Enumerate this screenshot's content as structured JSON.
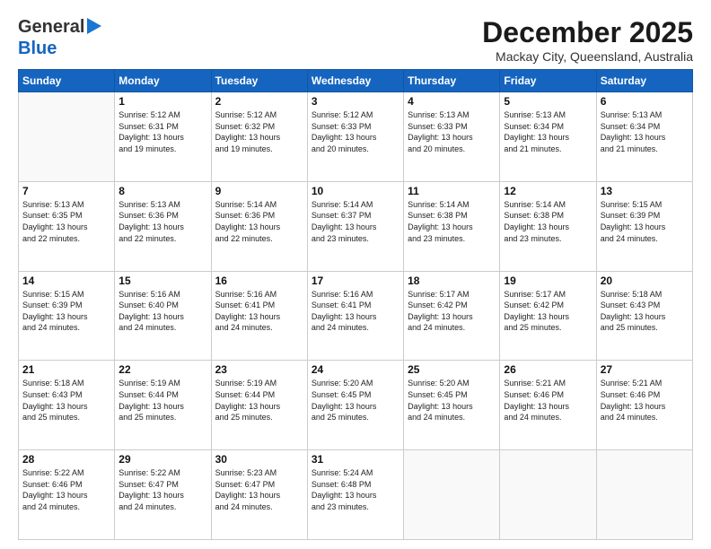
{
  "logo": {
    "line1": "General",
    "line2": "Blue"
  },
  "title": "December 2025",
  "subtitle": "Mackay City, Queensland, Australia",
  "weekdays": [
    "Sunday",
    "Monday",
    "Tuesday",
    "Wednesday",
    "Thursday",
    "Friday",
    "Saturday"
  ],
  "weeks": [
    [
      {
        "day": "",
        "info": ""
      },
      {
        "day": "1",
        "info": "Sunrise: 5:12 AM\nSunset: 6:31 PM\nDaylight: 13 hours\nand 19 minutes."
      },
      {
        "day": "2",
        "info": "Sunrise: 5:12 AM\nSunset: 6:32 PM\nDaylight: 13 hours\nand 19 minutes."
      },
      {
        "day": "3",
        "info": "Sunrise: 5:12 AM\nSunset: 6:33 PM\nDaylight: 13 hours\nand 20 minutes."
      },
      {
        "day": "4",
        "info": "Sunrise: 5:13 AM\nSunset: 6:33 PM\nDaylight: 13 hours\nand 20 minutes."
      },
      {
        "day": "5",
        "info": "Sunrise: 5:13 AM\nSunset: 6:34 PM\nDaylight: 13 hours\nand 21 minutes."
      },
      {
        "day": "6",
        "info": "Sunrise: 5:13 AM\nSunset: 6:34 PM\nDaylight: 13 hours\nand 21 minutes."
      }
    ],
    [
      {
        "day": "7",
        "info": "Sunrise: 5:13 AM\nSunset: 6:35 PM\nDaylight: 13 hours\nand 22 minutes."
      },
      {
        "day": "8",
        "info": "Sunrise: 5:13 AM\nSunset: 6:36 PM\nDaylight: 13 hours\nand 22 minutes."
      },
      {
        "day": "9",
        "info": "Sunrise: 5:14 AM\nSunset: 6:36 PM\nDaylight: 13 hours\nand 22 minutes."
      },
      {
        "day": "10",
        "info": "Sunrise: 5:14 AM\nSunset: 6:37 PM\nDaylight: 13 hours\nand 23 minutes."
      },
      {
        "day": "11",
        "info": "Sunrise: 5:14 AM\nSunset: 6:38 PM\nDaylight: 13 hours\nand 23 minutes."
      },
      {
        "day": "12",
        "info": "Sunrise: 5:14 AM\nSunset: 6:38 PM\nDaylight: 13 hours\nand 23 minutes."
      },
      {
        "day": "13",
        "info": "Sunrise: 5:15 AM\nSunset: 6:39 PM\nDaylight: 13 hours\nand 24 minutes."
      }
    ],
    [
      {
        "day": "14",
        "info": "Sunrise: 5:15 AM\nSunset: 6:39 PM\nDaylight: 13 hours\nand 24 minutes."
      },
      {
        "day": "15",
        "info": "Sunrise: 5:16 AM\nSunset: 6:40 PM\nDaylight: 13 hours\nand 24 minutes."
      },
      {
        "day": "16",
        "info": "Sunrise: 5:16 AM\nSunset: 6:41 PM\nDaylight: 13 hours\nand 24 minutes."
      },
      {
        "day": "17",
        "info": "Sunrise: 5:16 AM\nSunset: 6:41 PM\nDaylight: 13 hours\nand 24 minutes."
      },
      {
        "day": "18",
        "info": "Sunrise: 5:17 AM\nSunset: 6:42 PM\nDaylight: 13 hours\nand 24 minutes."
      },
      {
        "day": "19",
        "info": "Sunrise: 5:17 AM\nSunset: 6:42 PM\nDaylight: 13 hours\nand 25 minutes."
      },
      {
        "day": "20",
        "info": "Sunrise: 5:18 AM\nSunset: 6:43 PM\nDaylight: 13 hours\nand 25 minutes."
      }
    ],
    [
      {
        "day": "21",
        "info": "Sunrise: 5:18 AM\nSunset: 6:43 PM\nDaylight: 13 hours\nand 25 minutes."
      },
      {
        "day": "22",
        "info": "Sunrise: 5:19 AM\nSunset: 6:44 PM\nDaylight: 13 hours\nand 25 minutes."
      },
      {
        "day": "23",
        "info": "Sunrise: 5:19 AM\nSunset: 6:44 PM\nDaylight: 13 hours\nand 25 minutes."
      },
      {
        "day": "24",
        "info": "Sunrise: 5:20 AM\nSunset: 6:45 PM\nDaylight: 13 hours\nand 25 minutes."
      },
      {
        "day": "25",
        "info": "Sunrise: 5:20 AM\nSunset: 6:45 PM\nDaylight: 13 hours\nand 24 minutes."
      },
      {
        "day": "26",
        "info": "Sunrise: 5:21 AM\nSunset: 6:46 PM\nDaylight: 13 hours\nand 24 minutes."
      },
      {
        "day": "27",
        "info": "Sunrise: 5:21 AM\nSunset: 6:46 PM\nDaylight: 13 hours\nand 24 minutes."
      }
    ],
    [
      {
        "day": "28",
        "info": "Sunrise: 5:22 AM\nSunset: 6:46 PM\nDaylight: 13 hours\nand 24 minutes."
      },
      {
        "day": "29",
        "info": "Sunrise: 5:22 AM\nSunset: 6:47 PM\nDaylight: 13 hours\nand 24 minutes."
      },
      {
        "day": "30",
        "info": "Sunrise: 5:23 AM\nSunset: 6:47 PM\nDaylight: 13 hours\nand 24 minutes."
      },
      {
        "day": "31",
        "info": "Sunrise: 5:24 AM\nSunset: 6:48 PM\nDaylight: 13 hours\nand 23 minutes."
      },
      {
        "day": "",
        "info": ""
      },
      {
        "day": "",
        "info": ""
      },
      {
        "day": "",
        "info": ""
      }
    ]
  ]
}
